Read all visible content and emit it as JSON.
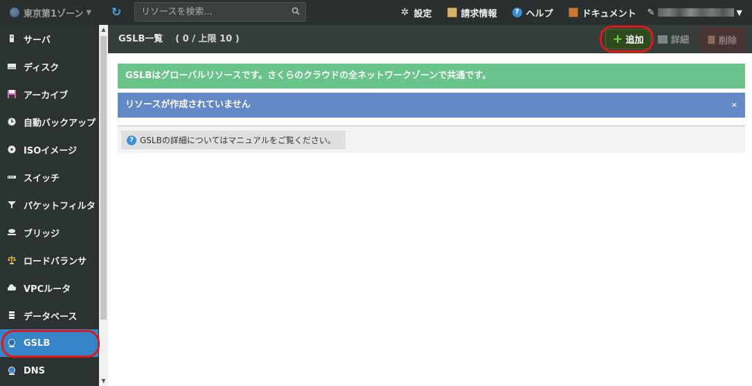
{
  "topbar": {
    "zone_label": "東京第1ゾーン",
    "search_placeholder": "リソースを検索...",
    "nav": {
      "settings": "設定",
      "billing": "請求情報",
      "help": "ヘルプ",
      "docs": "ドキュメント"
    }
  },
  "sidebar": {
    "items": [
      {
        "label": "サーバ",
        "icon": "server-icon"
      },
      {
        "label": "ディスク",
        "icon": "disk-icon"
      },
      {
        "label": "アーカイブ",
        "icon": "archive-icon"
      },
      {
        "label": "自動バックアップ",
        "icon": "clock-icon"
      },
      {
        "label": "ISOイメージ",
        "icon": "cd-icon"
      },
      {
        "label": "スイッチ",
        "icon": "switch-icon"
      },
      {
        "label": "パケットフィルタ",
        "icon": "filter-icon"
      },
      {
        "label": "ブリッジ",
        "icon": "bridge-icon"
      },
      {
        "label": "ロードバランサ",
        "icon": "balance-icon"
      },
      {
        "label": "VPCルータ",
        "icon": "cloud-icon"
      },
      {
        "label": "データベース",
        "icon": "database-icon"
      },
      {
        "label": "GSLB",
        "icon": "gslb-icon",
        "active": true
      },
      {
        "label": "DNS",
        "icon": "dns-icon"
      }
    ]
  },
  "main": {
    "title": "GSLB一覧",
    "count": "( 0 / 上限 10 )",
    "buttons": {
      "add": "追加",
      "detail": "詳細",
      "delete": "削除"
    },
    "alerts": {
      "global": "GSLBはグローバルリソースです。さくらのクラウドの全ネットワークゾーンで共通です。",
      "empty": "リソースが作成されていません",
      "close": "×"
    },
    "info": "GSLBの詳細についてはマニュアルをご覧ください。"
  },
  "colors": {
    "accent": "#3584c8",
    "success": "#69c48a",
    "info": "#6489c8",
    "highlight": "#e01818"
  }
}
